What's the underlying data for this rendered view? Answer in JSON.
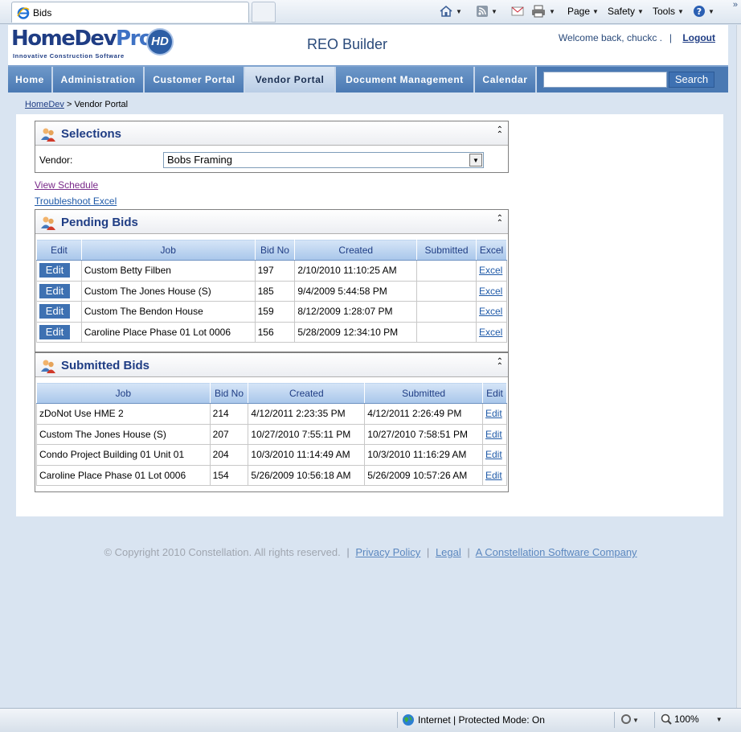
{
  "browser": {
    "tab_title": "Bids",
    "commands": [
      {
        "label": "",
        "icon": "home-icon"
      },
      {
        "label": "",
        "icon": "feeds-icon"
      },
      {
        "label": "",
        "icon": "mail-icon"
      },
      {
        "label": "",
        "icon": "print-icon"
      },
      {
        "label": "Page",
        "icon": ""
      },
      {
        "label": "Safety",
        "icon": ""
      },
      {
        "label": "Tools",
        "icon": ""
      },
      {
        "label": "",
        "icon": "help-icon"
      }
    ],
    "more": "»"
  },
  "header": {
    "logo_home": "HomeDev",
    "logo_pro": "Pro",
    "logo_hd": "HD",
    "logo_tagline": "Innovative Construction Software",
    "app_title": "REO Builder",
    "welcome": "Welcome back, chuckc .",
    "separator": "|",
    "logout": "Logout"
  },
  "nav": {
    "items": [
      "Home",
      "Administration",
      "Customer Portal",
      "Vendor Portal",
      "Document Management",
      "Calendar"
    ],
    "active": "Vendor Portal",
    "search_value": "",
    "search_button": "Search"
  },
  "breadcrumb": {
    "root": "HomeDev",
    "sep": " > ",
    "current": "Vendor Portal"
  },
  "selections": {
    "title": "Selections",
    "vendor_label": "Vendor:",
    "vendor_value": "Bobs Framing"
  },
  "links": {
    "view_schedule": "View Schedule",
    "troubleshoot_excel": "Troubleshoot Excel"
  },
  "pending": {
    "title": "Pending Bids",
    "columns": [
      "Edit",
      "Job",
      "Bid No",
      "Created",
      "Submitted",
      "Excel"
    ],
    "rows": [
      {
        "edit": "Edit",
        "job": "Custom Betty Filben",
        "bid_no": "197",
        "created": "2/10/2010 11:10:25 AM",
        "submitted": "",
        "excel": "Excel"
      },
      {
        "edit": "Edit",
        "job": "Custom The Jones House (S)",
        "bid_no": "185",
        "created": "9/4/2009 5:44:58 PM",
        "submitted": "",
        "excel": "Excel"
      },
      {
        "edit": "Edit",
        "job": "Custom The Bendon House",
        "bid_no": "159",
        "created": "8/12/2009 1:28:07 PM",
        "submitted": "",
        "excel": "Excel"
      },
      {
        "edit": "Edit",
        "job": "Caroline Place Phase 01 Lot 0006",
        "bid_no": "156",
        "created": "5/28/2009 12:34:10 PM",
        "submitted": "",
        "excel": "Excel"
      }
    ]
  },
  "submitted": {
    "title": "Submitted Bids",
    "columns": [
      "Job",
      "Bid No",
      "Created",
      "Submitted",
      "Edit"
    ],
    "rows": [
      {
        "job": "zDoNot Use HME 2",
        "bid_no": "214",
        "created": "4/12/2011 2:23:35 PM",
        "submitted": "4/12/2011 2:26:49 PM",
        "edit": "Edit"
      },
      {
        "job": "Custom The Jones House (S)",
        "bid_no": "207",
        "created": "10/27/2010 7:55:11 PM",
        "submitted": "10/27/2010 7:58:51 PM",
        "edit": "Edit"
      },
      {
        "job": "Condo Project Building 01 Unit 01",
        "bid_no": "204",
        "created": "10/3/2010 11:14:49 AM",
        "submitted": "10/3/2010 11:16:29 AM",
        "edit": "Edit"
      },
      {
        "job": "Caroline Place Phase 01 Lot 0006",
        "bid_no": "154",
        "created": "5/26/2009 10:56:18 AM",
        "submitted": "5/26/2009 10:57:26 AM",
        "edit": "Edit"
      }
    ]
  },
  "footer": {
    "copyright": "© Copyright 2010 Constellation. All rights reserved.",
    "sep": "|",
    "privacy": "Privacy Policy",
    "legal": "Legal",
    "company": "A Constellation Software Company"
  },
  "status": {
    "zone": "Internet | Protected Mode: On",
    "zoom": "100%"
  },
  "colors": {
    "nav": "#4a79b3",
    "accent": "#1f3d84",
    "button": "#3e71b2",
    "page_bg": "#d9e4f1"
  }
}
